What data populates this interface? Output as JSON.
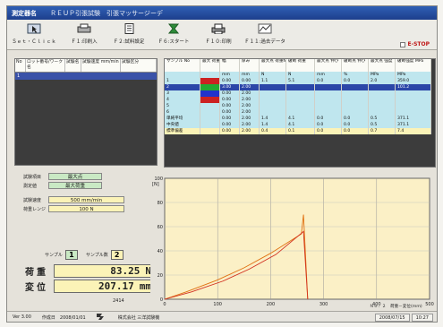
{
  "titlebar": {
    "app_name": "測定器名",
    "doc_title": "ＲＥＵＰ引張試験　引張マッサージーデ"
  },
  "toolbar": [
    {
      "label": "Ｓｅｔ・Ｃｌｉｃｋ",
      "icon": "cursor-icon"
    },
    {
      "label": "Ｆ１:印刷入",
      "icon": "printer-icon"
    },
    {
      "label": "Ｆ２:試料設定",
      "icon": "document-icon"
    },
    {
      "label": "Ｆ６:スタート",
      "icon": "start-icon"
    },
    {
      "label": "Ｆ１０:印刷",
      "icon": "print-icon"
    },
    {
      "label": "Ｆ１１:過去データ",
      "icon": "graph-icon"
    }
  ],
  "estop_label": "E-STOP",
  "test_list": {
    "headers": [
      "No",
      "ロット番号/ワーク名",
      "試験名",
      "試験速度\nmm/min",
      "試験区分"
    ],
    "rows": [
      [
        "1",
        "",
        "",
        "",
        ""
      ]
    ]
  },
  "results": {
    "headers": [
      "サンプル\nNo",
      "最大\n荷重",
      "幅",
      "厚み",
      "最大点\n荷重N",
      "破断\n荷重",
      "最大点\n伸び",
      "破断点\n伸び",
      "最大点\n強度",
      "破断強度\nMPa"
    ],
    "units": [
      "",
      "",
      "mm",
      "mm",
      "N",
      "N",
      "%",
      "%",
      "MPa",
      "MPa"
    ],
    "rows": [
      {
        "id": "r-unit",
        "cells": [
          "",
          "",
          "mm",
          "mm",
          "N",
          "N",
          "mm",
          "%",
          "MPa",
          "MPa"
        ],
        "style": "cyan"
      },
      {
        "id": "r1",
        "cells": [
          "1",
          "",
          "0.00",
          "0.00",
          "1.1",
          "5.1",
          "0.0",
          "0.0",
          "2.0",
          "359.0"
        ],
        "style": "cyan"
      },
      {
        "id": "r2",
        "cells": [
          "2",
          "",
          "3.00",
          "2.00",
          "",
          "",
          "",
          "",
          "",
          "101.2"
        ],
        "style": "sel"
      },
      {
        "id": "r3",
        "cells": [
          "3",
          "",
          "0.00",
          "2.00",
          "",
          "",
          "",
          "",
          "",
          ""
        ],
        "style": "cyan"
      },
      {
        "id": "r4",
        "cells": [
          "4",
          "",
          "0.00",
          "2.00",
          "",
          "",
          "",
          "",
          "",
          ""
        ],
        "style": "cyan"
      },
      {
        "id": "r5",
        "cells": [
          "5",
          "",
          "0.00",
          "2.00",
          "",
          "",
          "",
          "",
          "",
          ""
        ],
        "style": "cyan"
      },
      {
        "id": "r6",
        "cells": [
          "6",
          "",
          "0.00",
          "2.00",
          "",
          "",
          "",
          "",
          "",
          ""
        ],
        "style": "cyan"
      },
      {
        "id": "r-avg",
        "cells": [
          "単純平均",
          "",
          "0.00",
          "2.00",
          "1.4",
          "4.1",
          "0.0",
          "0.0",
          "0.5",
          "371.1"
        ],
        "style": "cyan"
      },
      {
        "id": "r-med",
        "cells": [
          "中央値",
          "",
          "0.00",
          "2.00",
          "1.4",
          "4.1",
          "0.0",
          "0.0",
          "0.5",
          "371.1"
        ],
        "style": "cyan"
      },
      {
        "id": "r-sd",
        "cells": [
          "標準偏差",
          "",
          "0.00",
          "2.00",
          "0.4",
          "0.1",
          "0.0",
          "0.0",
          "0.7",
          "7.4"
        ],
        "style": "yellow"
      }
    ],
    "swatches": [
      "#cc2222",
      "#22aa33",
      "#2233cc",
      "#cc2222"
    ]
  },
  "params": {
    "f1_label": "試験項目",
    "f1_value": "最大点",
    "f2_label": "測定値",
    "f2_value": "最大荷重",
    "speed_label": "試験速度",
    "speed_value": "500 mm/min",
    "range_label": "荷重レンジ",
    "range_value": "100 N"
  },
  "counters": {
    "sample_label": "サンプル",
    "sample_value": "1",
    "count_label": "サンプル数",
    "count_value": "2"
  },
  "readouts": {
    "load_label": "荷重",
    "load_value": "83.25",
    "load_unit": "N",
    "disp_label": "変位",
    "disp_value": "207.17",
    "disp_unit": "mm"
  },
  "bottom_counter": "2414",
  "chart_data": {
    "type": "line",
    "x_ticks": [
      "0",
      "100",
      "200",
      "300",
      "400",
      "500"
    ],
    "y_ticks": [
      "0",
      "20",
      "40",
      "60",
      "80",
      "100"
    ],
    "xlim": [
      0,
      500
    ],
    "ylim": [
      0,
      100
    ],
    "ylabel": "[N]",
    "xlabel_note": "Ｎｏ．２　荷重－変位(ｍｍ)",
    "series": [
      {
        "color": "#e07010",
        "x": [
          0,
          40,
          100,
          150,
          200,
          258,
          262,
          270
        ],
        "y": [
          0,
          6,
          16,
          26,
          38,
          54,
          70,
          0
        ]
      },
      {
        "color": "#d23020",
        "x": [
          0,
          50,
          110,
          160,
          210,
          262,
          270
        ],
        "y": [
          0,
          6,
          15,
          25,
          37,
          56,
          0
        ]
      }
    ]
  },
  "status": {
    "version": "Ver 3.00",
    "date_label": "作成日　2008/01/01",
    "company": "株式会社 三洋試験機",
    "date": "2008/07/15",
    "time": "10:27"
  }
}
